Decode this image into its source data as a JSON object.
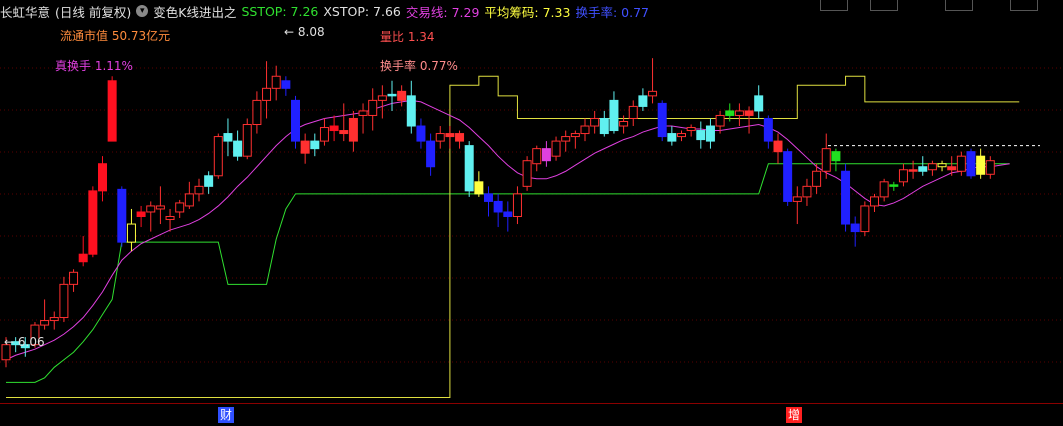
{
  "header": {
    "stock": "长虹华意",
    "period": "(日线 前复权)",
    "indicator": "变色K线进出之",
    "sstop": "SSTOP: 7.26",
    "xstop": "XSTOP: 7.66",
    "trade_line": "交易线: 7.29",
    "avg_cost": "平均筹码: 7.33",
    "turnover": "换手率: 0.77"
  },
  "annotations": {
    "float_cap": "流通市值 50.73亿元",
    "real_turnover": "真换手 1.11%",
    "volume_ratio": "量比 1.34",
    "turnover_rate": "换手率 0.77%",
    "high_label": "8.08",
    "low_label": "6.06"
  },
  "markers": {
    "m1": "财",
    "m2": "增"
  },
  "colors": {
    "up": "#ff3030",
    "down": "#2020ff",
    "bright_up": "#ff1020",
    "cyan": "#60f0f0",
    "green": "#20e020",
    "yellow": "#ffff40",
    "ma_magenta": "#e040e0",
    "stop_green": "#30e030",
    "stop_yellow": "#e0e040"
  },
  "chart_data": {
    "type": "candlestick",
    "ylim": [
      5.8,
      8.3
    ],
    "candles": [
      {
        "o": 6.1,
        "h": 6.25,
        "l": 6.05,
        "c": 6.2,
        "k": "r"
      },
      {
        "o": 6.2,
        "h": 6.25,
        "l": 6.15,
        "c": 6.22,
        "k": "c"
      },
      {
        "o": 6.18,
        "h": 6.25,
        "l": 6.12,
        "c": 6.2,
        "k": "c"
      },
      {
        "o": 6.2,
        "h": 6.35,
        "l": 6.18,
        "c": 6.33,
        "k": "r"
      },
      {
        "o": 6.33,
        "h": 6.5,
        "l": 6.3,
        "c": 6.36,
        "k": "r"
      },
      {
        "o": 6.36,
        "h": 6.42,
        "l": 6.3,
        "c": 6.38,
        "k": "r"
      },
      {
        "o": 6.38,
        "h": 6.65,
        "l": 6.35,
        "c": 6.6,
        "k": "r"
      },
      {
        "o": 6.6,
        "h": 6.7,
        "l": 6.55,
        "c": 6.68,
        "k": "r"
      },
      {
        "o": 6.75,
        "h": 6.92,
        "l": 6.72,
        "c": 6.8,
        "k": "R"
      },
      {
        "o": 6.8,
        "h": 7.25,
        "l": 6.78,
        "c": 7.22,
        "k": "R"
      },
      {
        "o": 7.4,
        "h": 7.45,
        "l": 7.15,
        "c": 7.22,
        "k": "R"
      },
      {
        "o": 7.55,
        "h": 7.98,
        "l": 7.55,
        "c": 7.95,
        "k": "R"
      },
      {
        "o": 7.23,
        "h": 7.25,
        "l": 6.85,
        "c": 6.88,
        "k": "b"
      },
      {
        "o": 6.88,
        "h": 7.1,
        "l": 6.82,
        "c": 7.0,
        "k": "y"
      },
      {
        "o": 7.05,
        "h": 7.12,
        "l": 6.98,
        "c": 7.08,
        "k": "R"
      },
      {
        "o": 7.08,
        "h": 7.15,
        "l": 6.95,
        "c": 7.12,
        "k": "r"
      },
      {
        "o": 7.1,
        "h": 7.25,
        "l": 7.0,
        "c": 7.12,
        "k": "r"
      },
      {
        "o": 7.03,
        "h": 7.1,
        "l": 6.95,
        "c": 7.05,
        "k": "r"
      },
      {
        "o": 7.08,
        "h": 7.16,
        "l": 7.04,
        "c": 7.14,
        "k": "r"
      },
      {
        "o": 7.12,
        "h": 7.28,
        "l": 7.1,
        "c": 7.2,
        "k": "r"
      },
      {
        "o": 7.2,
        "h": 7.3,
        "l": 7.15,
        "c": 7.25,
        "k": "r"
      },
      {
        "o": 7.25,
        "h": 7.35,
        "l": 7.2,
        "c": 7.32,
        "k": "c"
      },
      {
        "o": 7.32,
        "h": 7.6,
        "l": 7.3,
        "c": 7.58,
        "k": "r"
      },
      {
        "o": 7.55,
        "h": 7.7,
        "l": 7.45,
        "c": 7.6,
        "k": "c"
      },
      {
        "o": 7.55,
        "h": 7.62,
        "l": 7.42,
        "c": 7.45,
        "k": "c"
      },
      {
        "o": 7.45,
        "h": 7.7,
        "l": 7.43,
        "c": 7.66,
        "k": "r"
      },
      {
        "o": 7.66,
        "h": 7.88,
        "l": 7.6,
        "c": 7.82,
        "k": "r"
      },
      {
        "o": 7.82,
        "h": 8.08,
        "l": 7.7,
        "c": 7.9,
        "k": "r"
      },
      {
        "o": 7.9,
        "h": 8.05,
        "l": 7.82,
        "c": 7.98,
        "k": "r"
      },
      {
        "o": 7.95,
        "h": 7.98,
        "l": 7.85,
        "c": 7.9,
        "k": "b"
      },
      {
        "o": 7.82,
        "h": 7.85,
        "l": 7.5,
        "c": 7.55,
        "k": "b"
      },
      {
        "o": 7.55,
        "h": 7.6,
        "l": 7.4,
        "c": 7.47,
        "k": "r"
      },
      {
        "o": 7.55,
        "h": 7.6,
        "l": 7.45,
        "c": 7.5,
        "k": "c"
      },
      {
        "o": 7.55,
        "h": 7.7,
        "l": 7.52,
        "c": 7.64,
        "k": "r"
      },
      {
        "o": 7.65,
        "h": 7.72,
        "l": 7.55,
        "c": 7.62,
        "k": "R"
      },
      {
        "o": 7.62,
        "h": 7.8,
        "l": 7.55,
        "c": 7.6,
        "k": "r"
      },
      {
        "o": 7.7,
        "h": 7.75,
        "l": 7.48,
        "c": 7.55,
        "k": "r"
      },
      {
        "o": 7.72,
        "h": 7.8,
        "l": 7.6,
        "c": 7.75,
        "k": "r"
      },
      {
        "o": 7.72,
        "h": 7.9,
        "l": 7.62,
        "c": 7.82,
        "k": "r"
      },
      {
        "o": 7.82,
        "h": 7.92,
        "l": 7.7,
        "c": 7.85,
        "k": "r"
      },
      {
        "o": 7.85,
        "h": 7.95,
        "l": 7.75,
        "c": 7.86,
        "k": "c"
      },
      {
        "o": 7.88,
        "h": 7.92,
        "l": 7.78,
        "c": 7.82,
        "k": "r"
      },
      {
        "o": 7.85,
        "h": 7.95,
        "l": 7.6,
        "c": 7.65,
        "k": "c"
      },
      {
        "o": 7.65,
        "h": 7.7,
        "l": 7.5,
        "c": 7.55,
        "k": "b"
      },
      {
        "o": 7.55,
        "h": 7.6,
        "l": 7.32,
        "c": 7.38,
        "k": "b"
      },
      {
        "o": 7.55,
        "h": 7.65,
        "l": 7.5,
        "c": 7.6,
        "k": "r"
      },
      {
        "o": 7.6,
        "h": 7.65,
        "l": 7.5,
        "c": 7.58,
        "k": "r"
      },
      {
        "o": 7.6,
        "h": 7.62,
        "l": 7.5,
        "c": 7.55,
        "k": "r"
      },
      {
        "o": 7.52,
        "h": 7.55,
        "l": 7.18,
        "c": 7.22,
        "k": "c"
      },
      {
        "o": 7.28,
        "h": 7.35,
        "l": 7.18,
        "c": 7.2,
        "k": "y"
      },
      {
        "o": 7.2,
        "h": 7.25,
        "l": 7.05,
        "c": 7.15,
        "k": "b"
      },
      {
        "o": 7.15,
        "h": 7.2,
        "l": 6.98,
        "c": 7.08,
        "k": "b"
      },
      {
        "o": 7.08,
        "h": 7.15,
        "l": 6.95,
        "c": 7.05,
        "k": "b"
      },
      {
        "o": 7.05,
        "h": 7.25,
        "l": 7.0,
        "c": 7.2,
        "k": "r"
      },
      {
        "o": 7.25,
        "h": 7.45,
        "l": 7.22,
        "c": 7.42,
        "k": "r"
      },
      {
        "o": 7.4,
        "h": 7.52,
        "l": 7.35,
        "c": 7.5,
        "k": "r"
      },
      {
        "o": 7.5,
        "h": 7.55,
        "l": 7.38,
        "c": 7.42,
        "k": "m"
      },
      {
        "o": 7.45,
        "h": 7.58,
        "l": 7.42,
        "c": 7.55,
        "k": "r"
      },
      {
        "o": 7.55,
        "h": 7.62,
        "l": 7.48,
        "c": 7.58,
        "k": "r"
      },
      {
        "o": 7.58,
        "h": 7.62,
        "l": 7.5,
        "c": 7.6,
        "k": "r"
      },
      {
        "o": 7.6,
        "h": 7.7,
        "l": 7.55,
        "c": 7.65,
        "k": "r"
      },
      {
        "o": 7.65,
        "h": 7.75,
        "l": 7.6,
        "c": 7.7,
        "k": "r"
      },
      {
        "o": 7.6,
        "h": 7.75,
        "l": 7.58,
        "c": 7.7,
        "k": "c"
      },
      {
        "o": 7.82,
        "h": 7.88,
        "l": 7.6,
        "c": 7.62,
        "k": "c"
      },
      {
        "o": 7.65,
        "h": 7.72,
        "l": 7.6,
        "c": 7.68,
        "k": "r"
      },
      {
        "o": 7.7,
        "h": 7.82,
        "l": 7.65,
        "c": 7.78,
        "k": "r"
      },
      {
        "o": 7.78,
        "h": 7.9,
        "l": 7.75,
        "c": 7.85,
        "k": "c"
      },
      {
        "o": 7.85,
        "h": 8.1,
        "l": 7.8,
        "c": 7.88,
        "k": "r"
      },
      {
        "o": 7.8,
        "h": 7.82,
        "l": 7.55,
        "c": 7.58,
        "k": "b"
      },
      {
        "o": 7.6,
        "h": 7.65,
        "l": 7.52,
        "c": 7.55,
        "k": "c"
      },
      {
        "o": 7.58,
        "h": 7.62,
        "l": 7.55,
        "c": 7.6,
        "k": "r"
      },
      {
        "o": 7.62,
        "h": 7.66,
        "l": 7.58,
        "c": 7.64,
        "k": "r"
      },
      {
        "o": 7.62,
        "h": 7.68,
        "l": 7.5,
        "c": 7.56,
        "k": "c"
      },
      {
        "o": 7.55,
        "h": 7.7,
        "l": 7.5,
        "c": 7.65,
        "k": "c"
      },
      {
        "o": 7.65,
        "h": 7.75,
        "l": 7.6,
        "c": 7.72,
        "k": "r"
      },
      {
        "o": 7.72,
        "h": 7.8,
        "l": 7.68,
        "c": 7.75,
        "k": "g"
      },
      {
        "o": 7.72,
        "h": 7.8,
        "l": 7.65,
        "c": 7.75,
        "k": "r"
      },
      {
        "o": 7.75,
        "h": 7.78,
        "l": 7.6,
        "c": 7.72,
        "k": "r"
      },
      {
        "o": 7.85,
        "h": 7.92,
        "l": 7.7,
        "c": 7.75,
        "k": "c"
      },
      {
        "o": 7.7,
        "h": 7.72,
        "l": 7.5,
        "c": 7.55,
        "k": "b"
      },
      {
        "o": 7.55,
        "h": 7.6,
        "l": 7.4,
        "c": 7.48,
        "k": "r"
      },
      {
        "o": 7.48,
        "h": 7.5,
        "l": 7.12,
        "c": 7.15,
        "k": "b"
      },
      {
        "o": 7.15,
        "h": 7.25,
        "l": 7.0,
        "c": 7.18,
        "k": "r"
      },
      {
        "o": 7.18,
        "h": 7.3,
        "l": 7.12,
        "c": 7.25,
        "k": "r"
      },
      {
        "o": 7.25,
        "h": 7.4,
        "l": 7.2,
        "c": 7.35,
        "k": "r"
      },
      {
        "o": 7.35,
        "h": 7.6,
        "l": 7.3,
        "c": 7.5,
        "k": "r"
      },
      {
        "o": 7.42,
        "h": 7.5,
        "l": 7.35,
        "c": 7.48,
        "k": "g"
      },
      {
        "o": 7.35,
        "h": 7.4,
        "l": 6.95,
        "c": 7.0,
        "k": "b"
      },
      {
        "o": 7.0,
        "h": 7.05,
        "l": 6.85,
        "c": 6.95,
        "k": "b"
      },
      {
        "o": 6.95,
        "h": 7.15,
        "l": 6.92,
        "c": 7.12,
        "k": "r"
      },
      {
        "o": 7.12,
        "h": 7.2,
        "l": 7.08,
        "c": 7.18,
        "k": "r"
      },
      {
        "o": 7.18,
        "h": 7.3,
        "l": 7.15,
        "c": 7.28,
        "k": "r"
      },
      {
        "o": 7.25,
        "h": 7.28,
        "l": 7.22,
        "c": 7.26,
        "k": "g"
      },
      {
        "o": 7.28,
        "h": 7.4,
        "l": 7.25,
        "c": 7.36,
        "k": "r"
      },
      {
        "o": 7.36,
        "h": 7.42,
        "l": 7.3,
        "c": 7.35,
        "k": "r"
      },
      {
        "o": 7.35,
        "h": 7.45,
        "l": 7.32,
        "c": 7.38,
        "k": "c"
      },
      {
        "o": 7.36,
        "h": 7.42,
        "l": 7.32,
        "c": 7.4,
        "k": "r"
      },
      {
        "o": 7.38,
        "h": 7.42,
        "l": 7.35,
        "c": 7.4,
        "k": "y"
      },
      {
        "o": 7.38,
        "h": 7.45,
        "l": 7.32,
        "c": 7.36,
        "k": "r"
      },
      {
        "o": 7.35,
        "h": 7.48,
        "l": 7.32,
        "c": 7.45,
        "k": "r"
      },
      {
        "o": 7.48,
        "h": 7.5,
        "l": 7.3,
        "c": 7.32,
        "k": "b"
      },
      {
        "o": 7.45,
        "h": 7.5,
        "l": 7.3,
        "c": 7.33,
        "k": "y"
      },
      {
        "o": 7.33,
        "h": 7.45,
        "l": 7.3,
        "c": 7.42,
        "k": "r"
      }
    ],
    "ma": [
      6.1,
      6.13,
      6.15,
      6.17,
      6.2,
      6.23,
      6.27,
      6.32,
      6.38,
      6.46,
      6.55,
      6.66,
      6.76,
      6.82,
      6.87,
      6.9,
      6.93,
      6.96,
      6.98,
      7.0,
      7.03,
      7.07,
      7.12,
      7.18,
      7.25,
      7.31,
      7.38,
      7.45,
      7.52,
      7.58,
      7.63,
      7.66,
      7.68,
      7.7,
      7.71,
      7.72,
      7.73,
      7.74,
      7.76,
      7.78,
      7.8,
      7.81,
      7.82,
      7.81,
      7.78,
      7.75,
      7.72,
      7.69,
      7.64,
      7.58,
      7.52,
      7.45,
      7.39,
      7.34,
      7.31,
      7.3,
      7.3,
      7.32,
      7.35,
      7.39,
      7.43,
      7.47,
      7.5,
      7.53,
      7.56,
      7.58,
      7.61,
      7.63,
      7.65,
      7.65,
      7.64,
      7.63,
      7.63,
      7.62,
      7.62,
      7.63,
      7.64,
      7.65,
      7.66,
      7.64,
      7.61,
      7.56,
      7.5,
      7.44,
      7.38,
      7.34,
      7.31,
      7.27,
      7.22,
      7.17,
      7.13,
      7.12,
      7.14,
      7.17,
      7.21,
      7.25,
      7.28,
      7.31,
      7.34,
      7.35,
      7.37,
      7.38,
      7.38,
      7.39,
      7.4
    ],
    "trade_line": [
      5.95,
      5.95,
      5.95,
      5.95,
      5.98,
      6.05,
      6.1,
      6.15,
      6.22,
      6.3,
      6.4,
      6.5,
      6.88,
      6.88,
      6.88,
      6.88,
      6.88,
      6.88,
      6.88,
      6.88,
      6.88,
      6.88,
      6.88,
      6.6,
      6.6,
      6.6,
      6.6,
      6.6,
      6.9,
      7.1,
      7.2,
      7.2,
      7.2,
      7.2,
      7.2,
      7.2,
      7.2,
      7.2,
      7.2,
      7.2,
      7.2,
      7.2,
      7.2,
      7.2,
      7.2,
      7.2,
      7.2,
      7.2,
      7.2,
      7.2,
      7.2,
      7.2,
      7.2,
      7.2,
      7.2,
      7.2,
      7.2,
      7.2,
      7.2,
      7.2,
      7.2,
      7.2,
      7.2,
      7.2,
      7.2,
      7.2,
      7.2,
      7.2,
      7.2,
      7.2,
      7.2,
      7.2,
      7.2,
      7.2,
      7.2,
      7.2,
      7.2,
      7.2,
      7.2,
      7.4,
      7.4,
      7.4,
      7.4,
      7.4,
      7.4,
      7.4,
      7.4,
      7.4,
      7.4,
      7.4,
      7.4,
      7.4,
      7.4,
      7.4,
      7.4,
      7.4,
      7.4,
      7.4,
      7.4,
      7.4,
      7.4,
      7.4,
      7.4,
      7.4,
      7.4
    ],
    "stop_line_segments": [
      {
        "from": 0,
        "to": 46,
        "v": 5.85
      },
      {
        "from": 46,
        "to": 49,
        "v": 7.92
      },
      {
        "from": 49,
        "to": 51,
        "v": 7.98
      },
      {
        "from": 51,
        "to": 53,
        "v": 7.85
      },
      {
        "from": 53,
        "to": 82,
        "v": 7.7
      },
      {
        "from": 82,
        "to": 87,
        "v": 7.92
      },
      {
        "from": 87,
        "to": 89,
        "v": 7.98
      },
      {
        "from": 89,
        "to": 105,
        "v": 7.81
      }
    ]
  }
}
